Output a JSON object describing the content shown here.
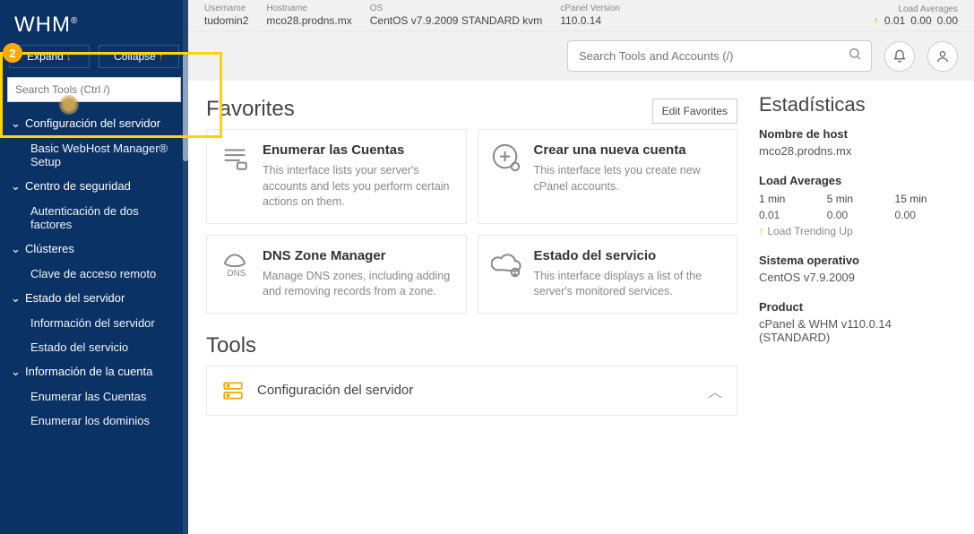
{
  "topstrip": {
    "username_lbl": "Username",
    "username_val": "tudomin2",
    "hostname_lbl": "Hostname",
    "hostname_val": "mco28.prodns.mx",
    "os_lbl": "OS",
    "os_val": "CentOS v7.9.2009 STANDARD kvm",
    "cpver_lbl": "cPanel Version",
    "cpver_val": "110.0.14",
    "la_lbl": "Load Averages",
    "la_1": "0.01",
    "la_5": "0.00",
    "la_15": "0.00"
  },
  "search_row": {
    "global_placeholder": "Search Tools and Accounts (/)"
  },
  "sidebar": {
    "brand": "WHM",
    "expand": "Expand",
    "collapse": "Collapse",
    "search_placeholder": "Search Tools (Ctrl /)",
    "sections": [
      {
        "label": "Configuración del servidor",
        "items": [
          "Basic WebHost Manager® Setup"
        ]
      },
      {
        "label": "Centro de seguridad",
        "items": [
          "Autenticación de dos factores"
        ]
      },
      {
        "label": "Clústeres",
        "items": [
          "Clave de acceso remoto"
        ]
      },
      {
        "label": "Estado del servidor",
        "items": [
          "Información del servidor",
          "Estado del servicio"
        ]
      },
      {
        "label": "Información de la cuenta",
        "items": [
          "Enumerar las Cuentas",
          "Enumerar los dominios"
        ]
      }
    ]
  },
  "favorites": {
    "title": "Favorites",
    "edit": "Edit Favorites",
    "cards": [
      {
        "title": "Enumerar las Cuentas",
        "desc": "This interface lists your server's accounts and lets you perform certain actions on them.",
        "icon": "list"
      },
      {
        "title": "Crear una nueva cuenta",
        "desc": "This interface lets you create new cPanel accounts.",
        "icon": "plus-user"
      },
      {
        "title": "DNS Zone Manager",
        "desc": "Manage DNS zones, including adding and removing records from a zone.",
        "icon": "dns"
      },
      {
        "title": "Estado del servicio",
        "desc": "This interface displays a list of the server's monitored services.",
        "icon": "cloud-alert"
      }
    ]
  },
  "tools": {
    "title": "Tools",
    "panel": "Configuración del servidor"
  },
  "stats": {
    "title": "Estadísticas",
    "host_lbl": "Nombre de host",
    "host_val": "mco28.prodns.mx",
    "la_lbl": "Load Averages",
    "la_1h": "1 min",
    "la_5h": "5 min",
    "la_15h": "15 min",
    "la_1": "0.01",
    "la_5": "0.00",
    "la_15": "0.00",
    "trend": "Load Trending Up",
    "os_lbl": "Sistema operativo",
    "os_val": "CentOS v7.9.2009",
    "prod_lbl": "Product",
    "prod_val": "cPanel & WHM v110.0.14 (STANDARD)"
  },
  "annotation_number": "2"
}
